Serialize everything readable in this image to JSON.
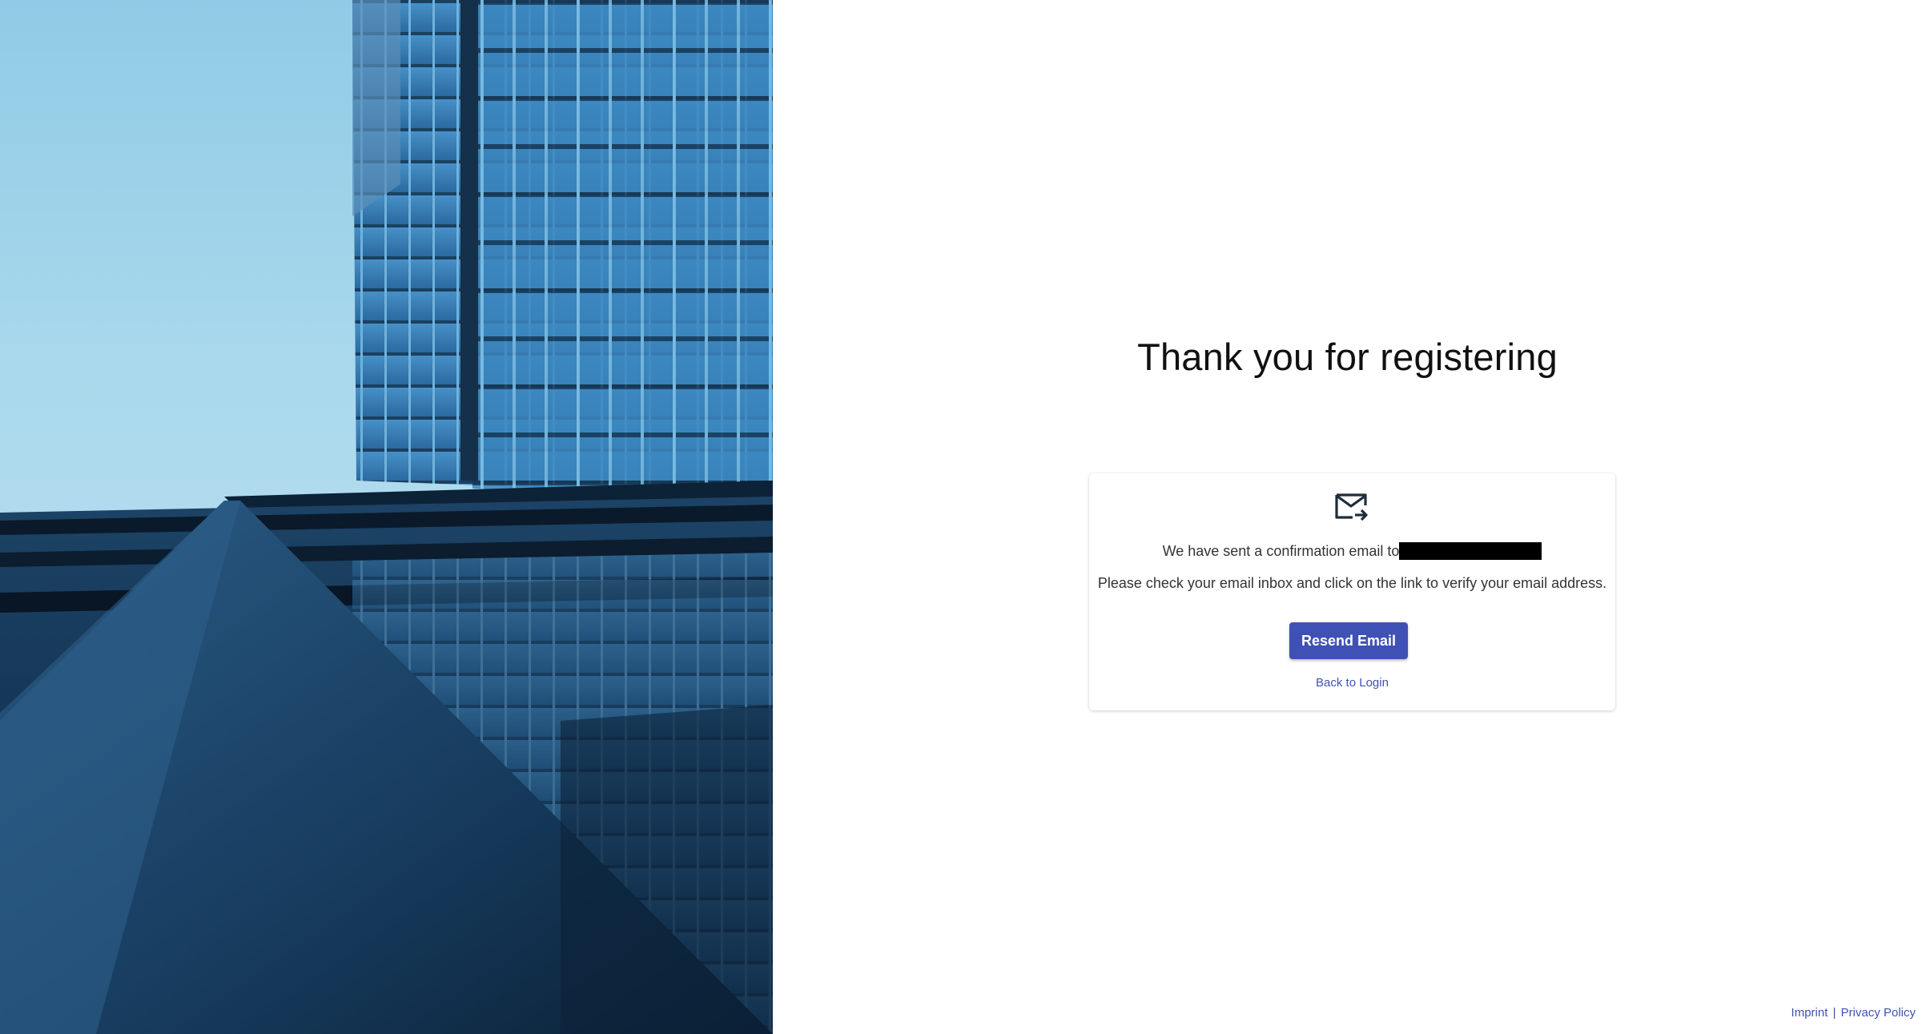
{
  "hero": {
    "image_icon": "building-photo"
  },
  "main": {
    "title": "Thank you for registering"
  },
  "card": {
    "icon": "mail-forward-icon",
    "sent_text": "We have sent a confirmation email to",
    "instruction_text": "Please check your email inbox and click on the link to verify your email address.",
    "resend_label": "Resend Email",
    "back_label": "Back to Login"
  },
  "footer": {
    "imprint_label": "Imprint",
    "separator": "|",
    "privacy_label": "Privacy Policy"
  },
  "colors": {
    "accent": "#3f51b5",
    "text": "#333333",
    "title": "#111111"
  }
}
